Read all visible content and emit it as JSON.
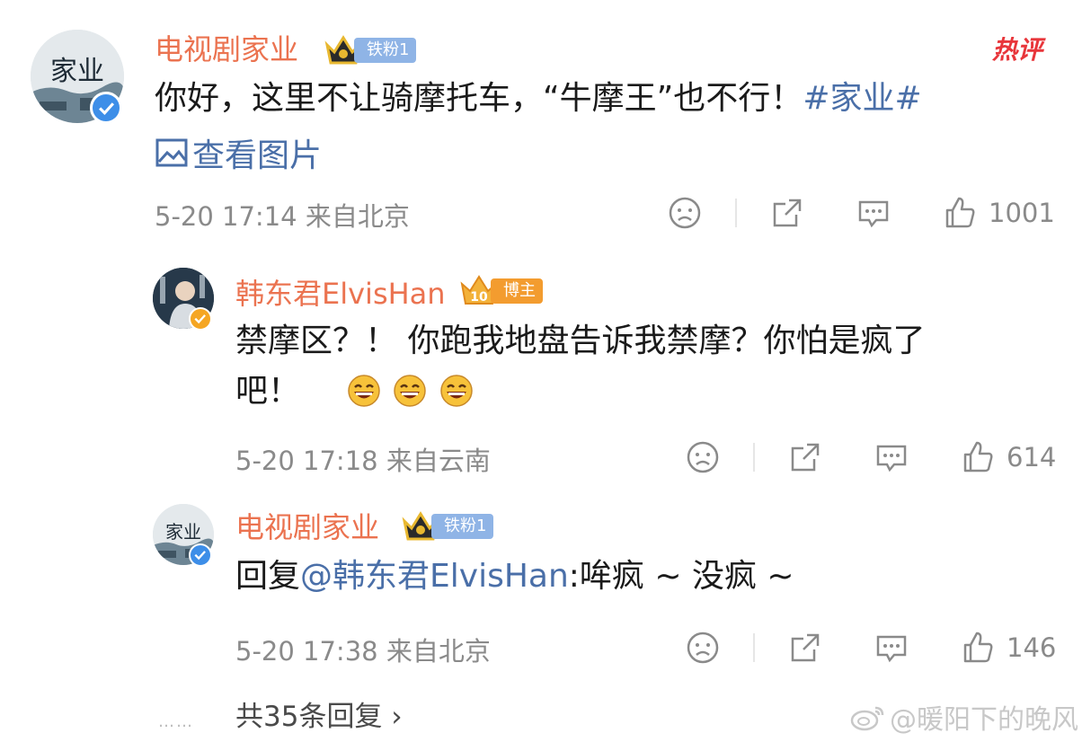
{
  "main_comment": {
    "username": "电视剧家业",
    "badge": "铁粉1",
    "hot_label": "热评",
    "avatar_text": "家业",
    "text_plain": "你好，这里不让骑摩托车，“牛摩王”也不行！",
    "topic": "#家业#",
    "view_pictures": "查看图片",
    "meta": "5-20 17:14 来自北京",
    "likes": "1001"
  },
  "replies": [
    {
      "username": "韩东君ElvisHan",
      "badge": "博主",
      "badge_level": "10",
      "line1": "禁摩区？！ 你跑我地盘告诉我禁摩？你怕是疯了",
      "line2": "吧！",
      "meta": "5-20 17:18 来自云南",
      "likes": "614"
    },
    {
      "username": "电视剧家业",
      "badge": "铁粉1",
      "avatar_text": "家业",
      "reply_prefix": "回复",
      "mention": "@韩东君ElvisHan",
      "reply_text": ":哞疯 ~ 没疯 ~",
      "meta": "5-20 17:38 来自北京",
      "likes": "146"
    }
  ],
  "more_replies": "共35条回复 ›",
  "more_dots": "……",
  "watermark": "@暖阳下的晚风",
  "colors": {
    "username": "#eb7350",
    "link": "#4a6fa8",
    "meta": "#8a8a8a",
    "hot": "#e8363b"
  }
}
